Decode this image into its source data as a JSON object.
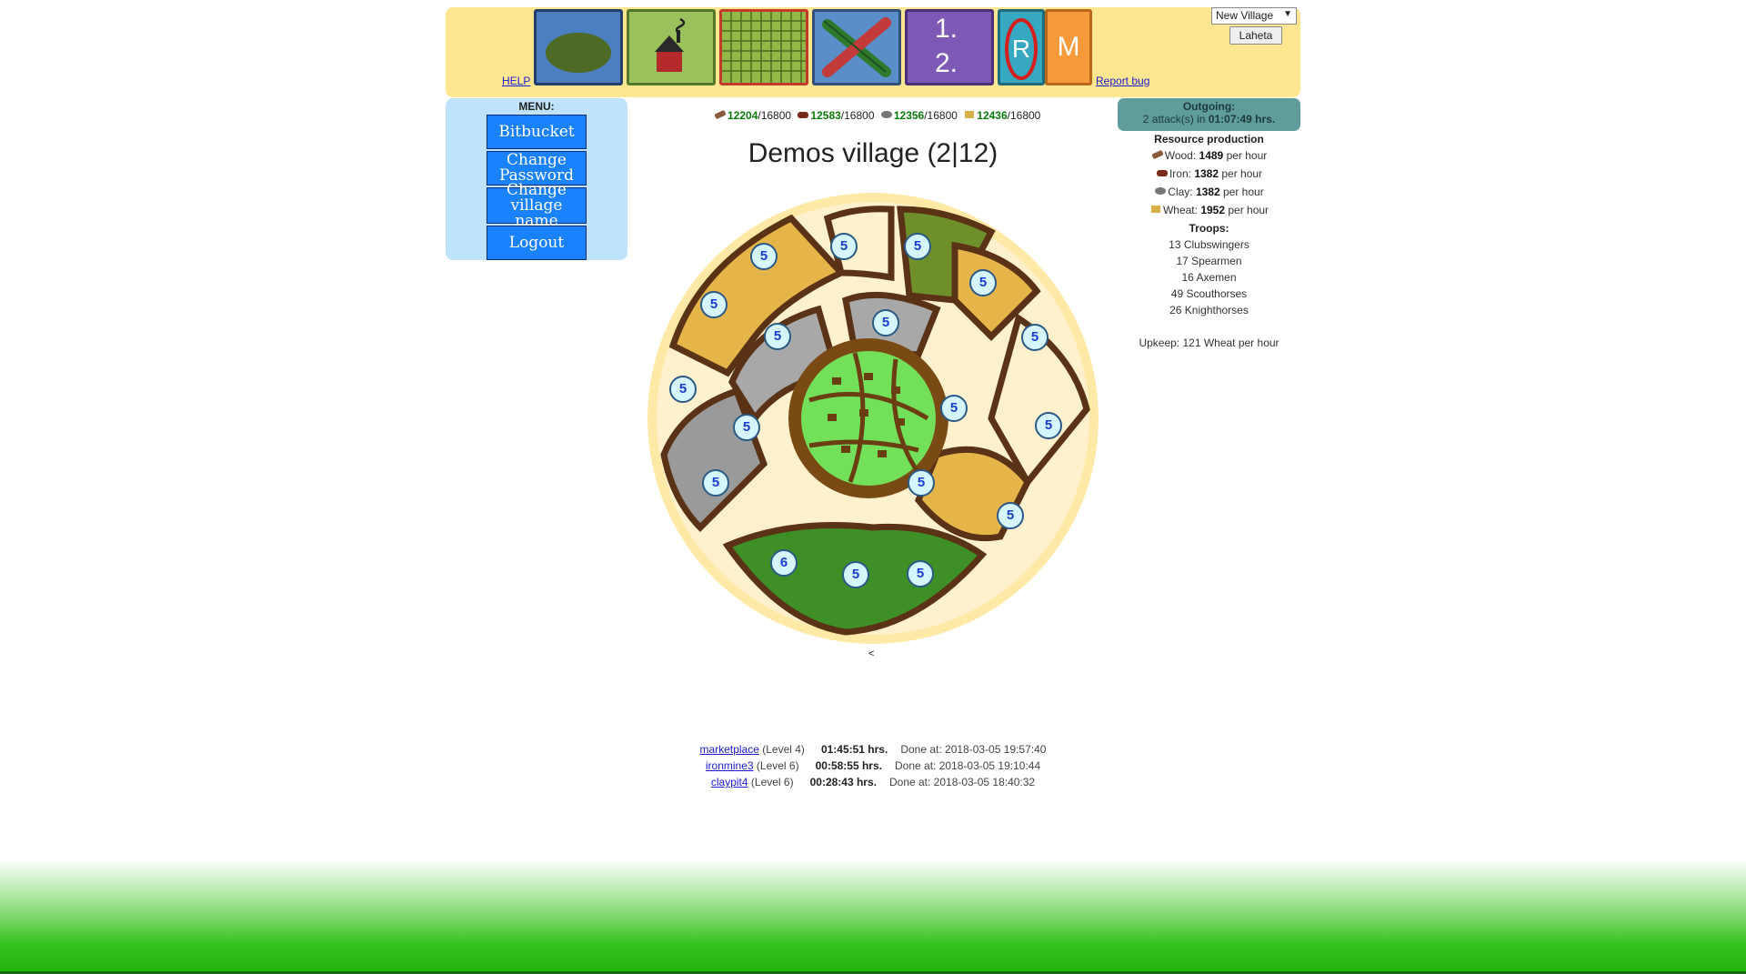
{
  "header": {
    "help_link": "HELP",
    "report_bug_link": "Report bug",
    "nav_buttons": [
      {
        "name": "map-button",
        "icon": "lake-map-icon",
        "bg": "#4a7fc0",
        "border": "#223e6a"
      },
      {
        "name": "village-button",
        "icon": "house-icon",
        "bg": "#9ac25c",
        "border": "#55752a"
      },
      {
        "name": "fields-button",
        "icon": "grid-field-icon",
        "bg": "#94b848",
        "border": "#c23a2a"
      },
      {
        "name": "attack-button",
        "icon": "crossed-swords-icon",
        "bg": "#5a8ec8",
        "border": "#2f4f7a"
      },
      {
        "name": "ranking-button",
        "label1": "1.",
        "label2": "2.",
        "bg": "#7d58b4",
        "border": "#4a2f78"
      },
      {
        "name": "reports-button",
        "label": "R",
        "bg": "#36a8c0",
        "border": "#1f6c7c"
      },
      {
        "name": "messages-button",
        "label": "M",
        "bg": "#f79a3c",
        "border": "#b9651a"
      }
    ],
    "village_select": {
      "selected": "New Village"
    },
    "submit_label": "Laheta"
  },
  "menu": {
    "title": "MENU:",
    "items": [
      {
        "label": "Bitbucket"
      },
      {
        "label": "Change Password"
      },
      {
        "label": "Change village name"
      },
      {
        "label": "Logout"
      }
    ]
  },
  "resources": [
    {
      "icon": "wood-icon",
      "current": "12204",
      "max": "/16800"
    },
    {
      "icon": "iron-icon",
      "current": "12583",
      "max": "/16800"
    },
    {
      "icon": "clay-icon",
      "current": "12356",
      "max": "/16800"
    },
    {
      "icon": "wheat-icon",
      "current": "12436",
      "max": "/16800"
    }
  ],
  "village_title": "Demos village (2|12)",
  "map": {
    "field_levels": [
      "5",
      "5",
      "5",
      "5",
      "5",
      "5",
      "5",
      "5",
      "5",
      "5",
      "5",
      "5",
      "5",
      "5",
      "5",
      "6",
      "5",
      "5"
    ],
    "back_arrow": "<"
  },
  "outgoing": {
    "title": "Outgoing:",
    "prefix": "2 attack(s) in ",
    "time": "01:07:49 hrs."
  },
  "production": {
    "title": "Resource production",
    "items": [
      {
        "icon": "wood-icon",
        "name": "Wood: ",
        "value": "1489",
        "suffix": " per hour"
      },
      {
        "icon": "iron-icon",
        "name": "Iron: ",
        "value": "1382",
        "suffix": " per hour"
      },
      {
        "icon": "clay-icon",
        "name": "Clay: ",
        "value": "1382",
        "suffix": " per hour"
      },
      {
        "icon": "wheat-icon",
        "name": "Wheat: ",
        "value": "1952",
        "suffix": " per hour"
      }
    ]
  },
  "troops": {
    "title": "Troops:",
    "items": [
      "13 Clubswingers",
      "17 Spearmen",
      "16 Axemen",
      "49 Scouthorses",
      "26 Knighthorses"
    ],
    "upkeep": "Upkeep: 121 Wheat per hour"
  },
  "queue": [
    {
      "link": "marketplace",
      "level": " (Level 4)",
      "time": "01:45:51 hrs.",
      "done": "Done at: 2018-03-05 19:57:40"
    },
    {
      "link": "ironmine3",
      "level": " (Level 6)",
      "time": "00:58:55 hrs.",
      "done": "Done at: 2018-03-05 19:10:44"
    },
    {
      "link": "claypit4",
      "level": " (Level 6)",
      "time": "00:28:43 hrs.",
      "done": "Done at: 2018-03-05 18:40:32"
    }
  ]
}
